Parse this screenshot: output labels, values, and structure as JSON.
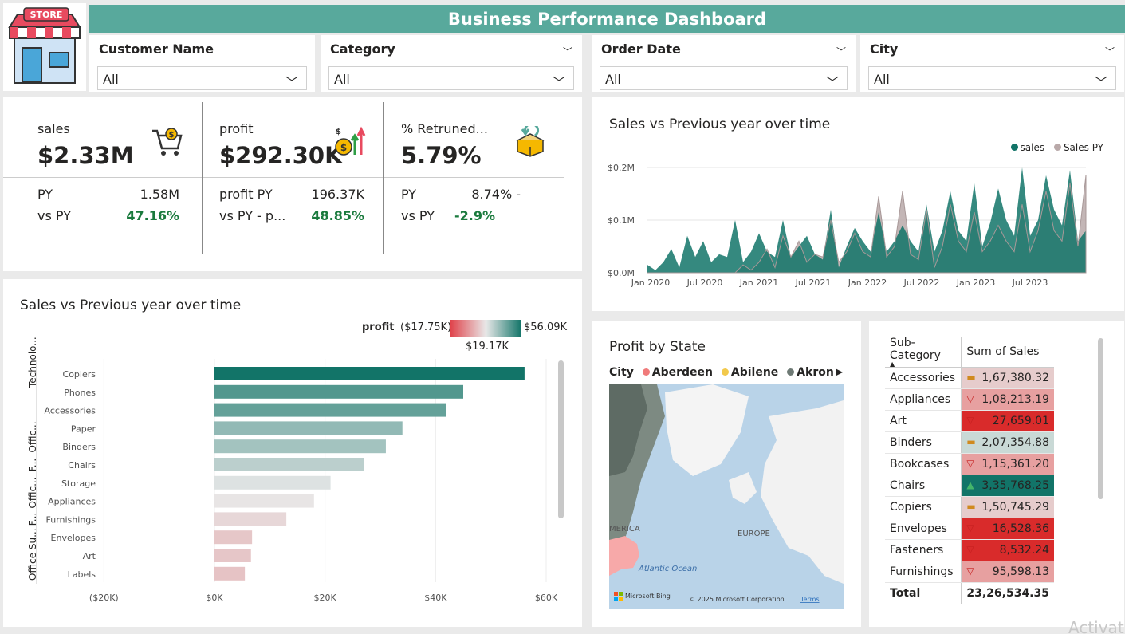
{
  "header": {
    "title": "Business Performance Dashboard",
    "logo_text": "STORE"
  },
  "slicers": [
    {
      "label": "Customer Name",
      "value": "All"
    },
    {
      "label": "Category",
      "value": "All"
    },
    {
      "label": "Order Date",
      "value": "All"
    },
    {
      "label": "City",
      "value": "All"
    }
  ],
  "kpis": [
    {
      "name": "sales",
      "value": "$2.33M",
      "py_label": "PY",
      "py_value": "1.58M",
      "vs_label": "vs PY",
      "vs_value": "47.16%",
      "icon": "shopping-cart-icon"
    },
    {
      "name": "profit",
      "value": "$292.30K",
      "py_label": "profit PY",
      "py_value": "196.37K",
      "vs_label": "vs PY - p...",
      "vs_value": "48.85%",
      "icon": "money-growth-icon"
    },
    {
      "name": "% Retruned...",
      "value": "5.79%",
      "py_label": "PY",
      "py_value": "8.74% -",
      "vs_label": "vs PY",
      "vs_value": "-2.9%",
      "icon": "return-box-icon"
    }
  ],
  "line_chart": {
    "title": "Sales vs Previous year over time",
    "legend": [
      "sales",
      "Sales PY"
    ]
  },
  "bar_chart": {
    "title": "Sales vs Previous year over time",
    "gradient_label": "profit",
    "gradient_min": "($17.75K)",
    "gradient_mid": "$19.17K",
    "gradient_max": "$56.09K",
    "groups": [
      "Technolo...",
      "Offic...",
      "F...",
      "Offic...",
      "F...",
      "Office Su..."
    ]
  },
  "map": {
    "title": "Profit by State",
    "legend_label": "City",
    "legend_items": [
      "Aberdeen",
      "Abilene",
      "Akron"
    ],
    "labels": {
      "america": "MERICA",
      "europe": "EUROPE",
      "ocean": "Atlantic Ocean"
    },
    "bing": "Microsoft Bing",
    "copyright": "© 2025 Microsoft Corporation",
    "terms": "Terms"
  },
  "table": {
    "headers": [
      "Sub-Category",
      "Sum of Sales"
    ],
    "rows": [
      {
        "name": "Accessories",
        "value": "1,67,380.32",
        "indicator": "neutral"
      },
      {
        "name": "Appliances",
        "value": "1,08,213.19",
        "indicator": "down"
      },
      {
        "name": "Art",
        "value": "27,659.01",
        "indicator": "down"
      },
      {
        "name": "Binders",
        "value": "2,07,354.88",
        "indicator": "neutral"
      },
      {
        "name": "Bookcases",
        "value": "1,15,361.20",
        "indicator": "down"
      },
      {
        "name": "Chairs",
        "value": "3,35,768.25",
        "indicator": "up"
      },
      {
        "name": "Copiers",
        "value": "1,50,745.29",
        "indicator": "neutral"
      },
      {
        "name": "Envelopes",
        "value": "16,528.36",
        "indicator": "down"
      },
      {
        "name": "Fasteners",
        "value": "8,532.24",
        "indicator": "down"
      },
      {
        "name": "Furnishings",
        "value": "95,598.13",
        "indicator": "down"
      }
    ],
    "total_label": "Total",
    "total_value": "23,26,534.35"
  },
  "watermark": "Activat",
  "colors": {
    "accent": "#58a99c",
    "teal_dark": "#127468",
    "py_gray": "#b9a9a9",
    "negative": "#d93a3a",
    "positive_text": "#1a7a3d"
  },
  "chart_data": [
    {
      "type": "area",
      "title": "Sales vs Previous year over time",
      "x_ticks": [
        "Jan 2020",
        "Jul 2020",
        "Jan 2021",
        "Jul 2021",
        "Jan 2022",
        "Jul 2022",
        "Jan 2023",
        "Jul 2023"
      ],
      "y_ticks": [
        "$0.0M",
        "$0.1M",
        "$0.2M"
      ],
      "ylim": [
        0,
        0.2
      ],
      "series": [
        {
          "name": "sales",
          "values": [
            0.015,
            0.005,
            0.02,
            0.045,
            0.01,
            0.07,
            0.03,
            0.06,
            0.02,
            0.035,
            0.03,
            0.1,
            0.02,
            0.04,
            0.075,
            0.04,
            0.03,
            0.1,
            0.03,
            0.05,
            0.07,
            0.035,
            0.025,
            0.12,
            0.01,
            0.05,
            0.085,
            0.06,
            0.04,
            0.115,
            0.04,
            0.06,
            0.09,
            0.06,
            0.04,
            0.13,
            0.04,
            0.08,
            0.155,
            0.08,
            0.06,
            0.17,
            0.05,
            0.095,
            0.16,
            0.1,
            0.07,
            0.2,
            0.07,
            0.1,
            0.185,
            0.12,
            0.09,
            0.195,
            0.06,
            0.08
          ]
        },
        {
          "name": "Sales PY",
          "values": [
            0,
            0,
            0,
            0,
            0,
            0,
            0,
            0,
            0,
            0,
            0,
            0,
            0.015,
            0.005,
            0.02,
            0.045,
            0.01,
            0.07,
            0.03,
            0.06,
            0.02,
            0.035,
            0.03,
            0.1,
            0.02,
            0.04,
            0.075,
            0.04,
            0.03,
            0.145,
            0.03,
            0.05,
            0.155,
            0.035,
            0.025,
            0.12,
            0.01,
            0.05,
            0.13,
            0.06,
            0.04,
            0.115,
            0.04,
            0.06,
            0.09,
            0.06,
            0.04,
            0.13,
            0.04,
            0.08,
            0.155,
            0.08,
            0.06,
            0.17,
            0.05,
            0.185
          ]
        }
      ]
    },
    {
      "type": "bar",
      "orientation": "horizontal",
      "title": "Sales vs Previous year over time",
      "categories": [
        "Copiers",
        "Phones",
        "Accessories",
        "Paper",
        "Binders",
        "Chairs",
        "Storage",
        "Appliances",
        "Furnishings",
        "Envelopes",
        "Art",
        "Labels"
      ],
      "values": [
        56.09,
        45.0,
        41.9,
        34.0,
        31.0,
        27.0,
        21.0,
        18.0,
        13.0,
        6.8,
        6.6,
        5.5
      ],
      "x_ticks": [
        "($20K)",
        "$0K",
        "$20K",
        "$40K",
        "$60K"
      ],
      "xlim": [
        -20,
        60
      ],
      "color_scale": {
        "min": -17.75,
        "mid": 19.17,
        "max": 56.09
      }
    }
  ]
}
